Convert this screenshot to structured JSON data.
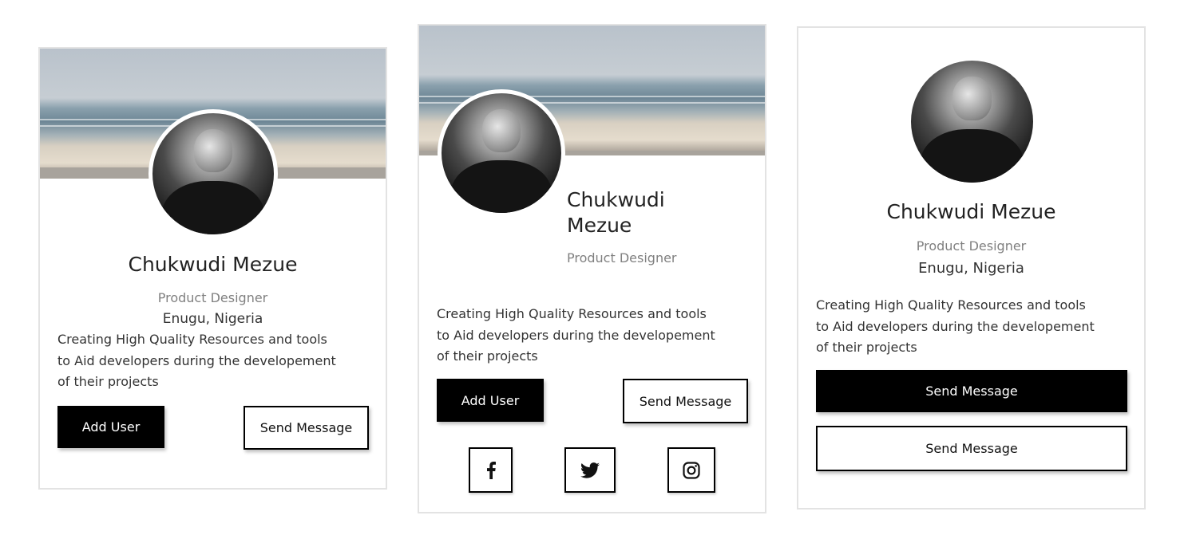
{
  "profile": {
    "name": "Chukwudi Mezue",
    "name_line1": "Chukwudi",
    "name_line2": "Mezue",
    "title": "Product Designer",
    "location": "Enugu, Nigeria",
    "bio_lines": [
      "Creating High Quality Resources and tools",
      "to Aid developers during the developement",
      "of their projects"
    ]
  },
  "buttons": {
    "add_user": "Add User",
    "send_message": "Send Message"
  },
  "social": {
    "icons": [
      "facebook-icon",
      "twitter-icon",
      "instagram-icon"
    ]
  },
  "colors": {
    "accent": "#000000",
    "muted_text": "#808080",
    "border": "#e3e3e3"
  }
}
